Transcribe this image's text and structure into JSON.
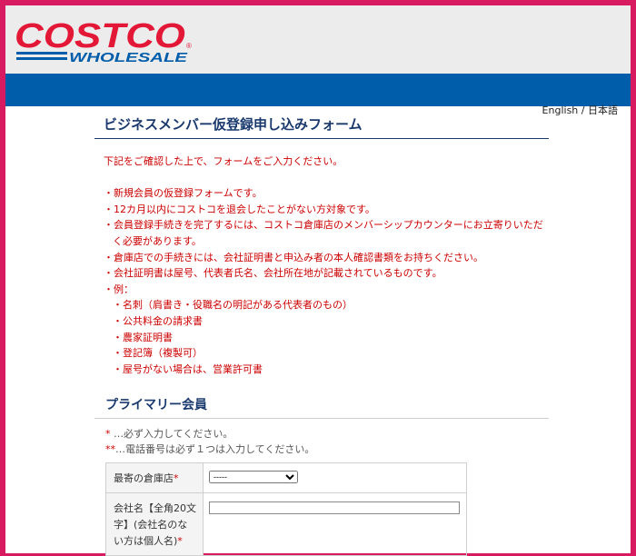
{
  "header": {
    "logo_top": "COSTCO",
    "logo_bottom": "WHOLESALE",
    "logo_mark": "®",
    "brand_red": "#e31837",
    "brand_blue": "#005daa"
  },
  "lang": {
    "english": "English",
    "sep": "/",
    "japanese": "日本語"
  },
  "page": {
    "title": "ビジネスメンバー仮登録申し込みフォーム"
  },
  "notes": {
    "intro": "下記をご確認した上で、フォームをご入力ください。",
    "items": [
      "・新規会員の仮登録フォームです。",
      "・12カ月以内にコストコを退会したことがない方対象です。",
      "・会員登録手続きを完了するには、コストコ倉庫店のメンバーシップカウンターにお立寄りいただく必要があります。",
      "・倉庫店での手続きには、会社証明書と申込み者の本人確認書類をお持ちください。",
      "・会社証明書は屋号、代表者氏名、会社所在地が記載されているものです。",
      "・例："
    ],
    "examples": [
      "・名刺（肩書き・役職名の明記がある代表者のもの）",
      "・公共料金の請求書",
      "・農家証明書",
      "・登記簿（複製可）",
      "・屋号がない場合は、営業許可書"
    ]
  },
  "section": {
    "title": "プライマリー会員"
  },
  "legend": {
    "req_mark_1": "*",
    "line1": " …必ず入力してください。",
    "req_mark_2": "**",
    "line2": "…電話番号は必ず１つは入力してください。"
  },
  "form": {
    "store_label": "最寄の倉庫店",
    "store_req": "*",
    "store_selected": "-----",
    "company_label": "会社名【全角20文字】(会社名のない方は個人名)",
    "company_req": "*",
    "company_value": ""
  }
}
